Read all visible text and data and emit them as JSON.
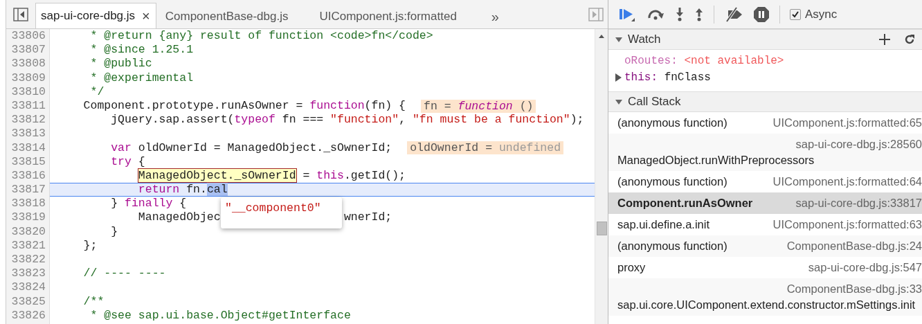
{
  "editor": {
    "tabs": [
      {
        "label": "sap-ui-core-dbg.js",
        "selected": true,
        "close": "×"
      },
      {
        "label": "ComponentBase-dbg.js",
        "selected": false
      },
      {
        "label": "UIComponent.js:formatted",
        "selected": false
      }
    ],
    "overflow": "»",
    "lines": [
      {
        "number": "33806",
        "current": false,
        "tokens": [
          {
            "kind": "comment",
            "text": "     * @return {any} result of function <code>fn</code>"
          }
        ]
      },
      {
        "number": "33807",
        "current": false,
        "tokens": [
          {
            "kind": "comment",
            "text": "     * @since 1.25.1"
          }
        ]
      },
      {
        "number": "33808",
        "current": false,
        "tokens": [
          {
            "kind": "comment",
            "text": "     * @public"
          }
        ]
      },
      {
        "number": "33809",
        "current": false,
        "tokens": [
          {
            "kind": "comment",
            "text": "     * @experimental"
          }
        ]
      },
      {
        "number": "33810",
        "current": false,
        "tokens": [
          {
            "kind": "comment",
            "text": "     */"
          }
        ]
      },
      {
        "number": "33811",
        "current": false,
        "tokens": [
          {
            "kind": "plain",
            "text": "    Component.prototype.runAsOwner = "
          },
          {
            "kind": "keyword",
            "text": "function"
          },
          {
            "kind": "plain",
            "text": "(fn) {"
          }
        ],
        "inline": [
          {
            "kind": "plain",
            "text": "fn = "
          },
          {
            "kind": "function_value",
            "text": "function"
          },
          {
            "kind": "plain",
            "text": " ()"
          }
        ]
      },
      {
        "number": "33812",
        "current": false,
        "tokens": [
          {
            "kind": "plain",
            "text": "        jQuery.sap.assert("
          },
          {
            "kind": "keyword",
            "text": "typeof"
          },
          {
            "kind": "plain",
            "text": " fn === "
          },
          {
            "kind": "string",
            "text": "\"function\""
          },
          {
            "kind": "plain",
            "text": ", "
          },
          {
            "kind": "string",
            "text": "\"fn must be a function\""
          },
          {
            "kind": "plain",
            "text": ");"
          }
        ]
      },
      {
        "number": "33813",
        "current": false
      },
      {
        "number": "33814",
        "current": false,
        "tokens": [
          {
            "kind": "keyword",
            "text": "        var"
          },
          {
            "kind": "plain",
            "text": " oldOwnerId = ManagedObject._sOwnerId;"
          }
        ],
        "inline": [
          {
            "kind": "plain",
            "text": "oldOwnerId = "
          },
          {
            "kind": "undefined_value",
            "text": "undefined"
          }
        ]
      },
      {
        "number": "33815",
        "current": false,
        "tokens": [
          {
            "kind": "keyword",
            "text": "        try"
          },
          {
            "kind": "plain",
            "text": " {"
          }
        ]
      },
      {
        "number": "33816",
        "current": false,
        "tokens": [
          {
            "kind": "hover",
            "text": "            ManagedObject._sOwnerId"
          },
          {
            "kind": "plain",
            "text": " = "
          },
          {
            "kind": "keyword",
            "text": "this"
          },
          {
            "kind": "plain",
            "text": ".getId();"
          }
        ]
      },
      {
        "number": "33817",
        "current": true,
        "tokens": [
          {
            "kind": "keyword",
            "text": "            return"
          },
          {
            "kind": "plain",
            "text": " fn."
          },
          {
            "kind": "selection",
            "text": "cal"
          }
        ]
      },
      {
        "number": "33818",
        "current": false,
        "tokens": [
          {
            "kind": "plain",
            "text": "        } "
          },
          {
            "kind": "keyword",
            "text": "finally"
          },
          {
            "kind": "plain",
            "text": " {"
          }
        ]
      },
      {
        "number": "33819",
        "current": false,
        "tokens": [
          {
            "kind": "plain",
            "text": "            ManagedObjec                  wnerId;"
          }
        ]
      },
      {
        "number": "33820",
        "current": false,
        "tokens": [
          {
            "kind": "plain",
            "text": "        }"
          }
        ]
      },
      {
        "number": "33821",
        "current": false,
        "tokens": [
          {
            "kind": "plain",
            "text": "    };"
          }
        ]
      },
      {
        "number": "33822",
        "current": false
      },
      {
        "number": "33823",
        "current": false,
        "tokens": [
          {
            "kind": "comment",
            "text": "    // ---- ----"
          }
        ]
      },
      {
        "number": "33824",
        "current": false
      },
      {
        "number": "33825",
        "current": false,
        "tokens": [
          {
            "kind": "comment",
            "text": "    /**"
          }
        ]
      },
      {
        "number": "33826",
        "current": false,
        "tokens": [
          {
            "kind": "comment",
            "text": "     * @see sap.ui.base.Object#getInterface"
          }
        ]
      }
    ],
    "popover": {
      "value": "\"__component0\""
    }
  },
  "debugger": {
    "async": {
      "label": "Async",
      "checked": true
    },
    "watch": {
      "title": "Watch",
      "expanded": true,
      "items": [
        {
          "name": "oRoutes:",
          "value": "<not available>",
          "kind": "unavailable",
          "expandable": false
        },
        {
          "name": "this:",
          "value": "fnClass",
          "kind": "object",
          "expandable": true
        }
      ]
    },
    "call_stack": {
      "title": "Call Stack",
      "expanded": true,
      "frames": [
        {
          "name": "(anonymous function)",
          "location": "UIComponent.js:formatted:65",
          "selected": false
        },
        {
          "name": "ManagedObject.runWithPreprocessors",
          "location": "sap-ui-core-dbg.js:28560",
          "selected": false
        },
        {
          "name": "(anonymous function)",
          "location": "UIComponent.js:formatted:64",
          "selected": false
        },
        {
          "name": "Component.runAsOwner",
          "location": "sap-ui-core-dbg.js:33817",
          "selected": true
        },
        {
          "name": "sap.ui.define.a.init",
          "location": "UIComponent.js:formatted:63",
          "selected": false
        },
        {
          "name": "(anonymous function)",
          "location": "ComponentBase-dbg.js:24",
          "selected": false
        },
        {
          "name": "proxy",
          "location": "sap-ui-core-dbg.js:547",
          "selected": false
        },
        {
          "name": "sap.ui.core.UIComponent.extend.constructor.mSettings.init",
          "location": "ComponentBase-dbg.js:33",
          "selected": false
        }
      ]
    }
  }
}
